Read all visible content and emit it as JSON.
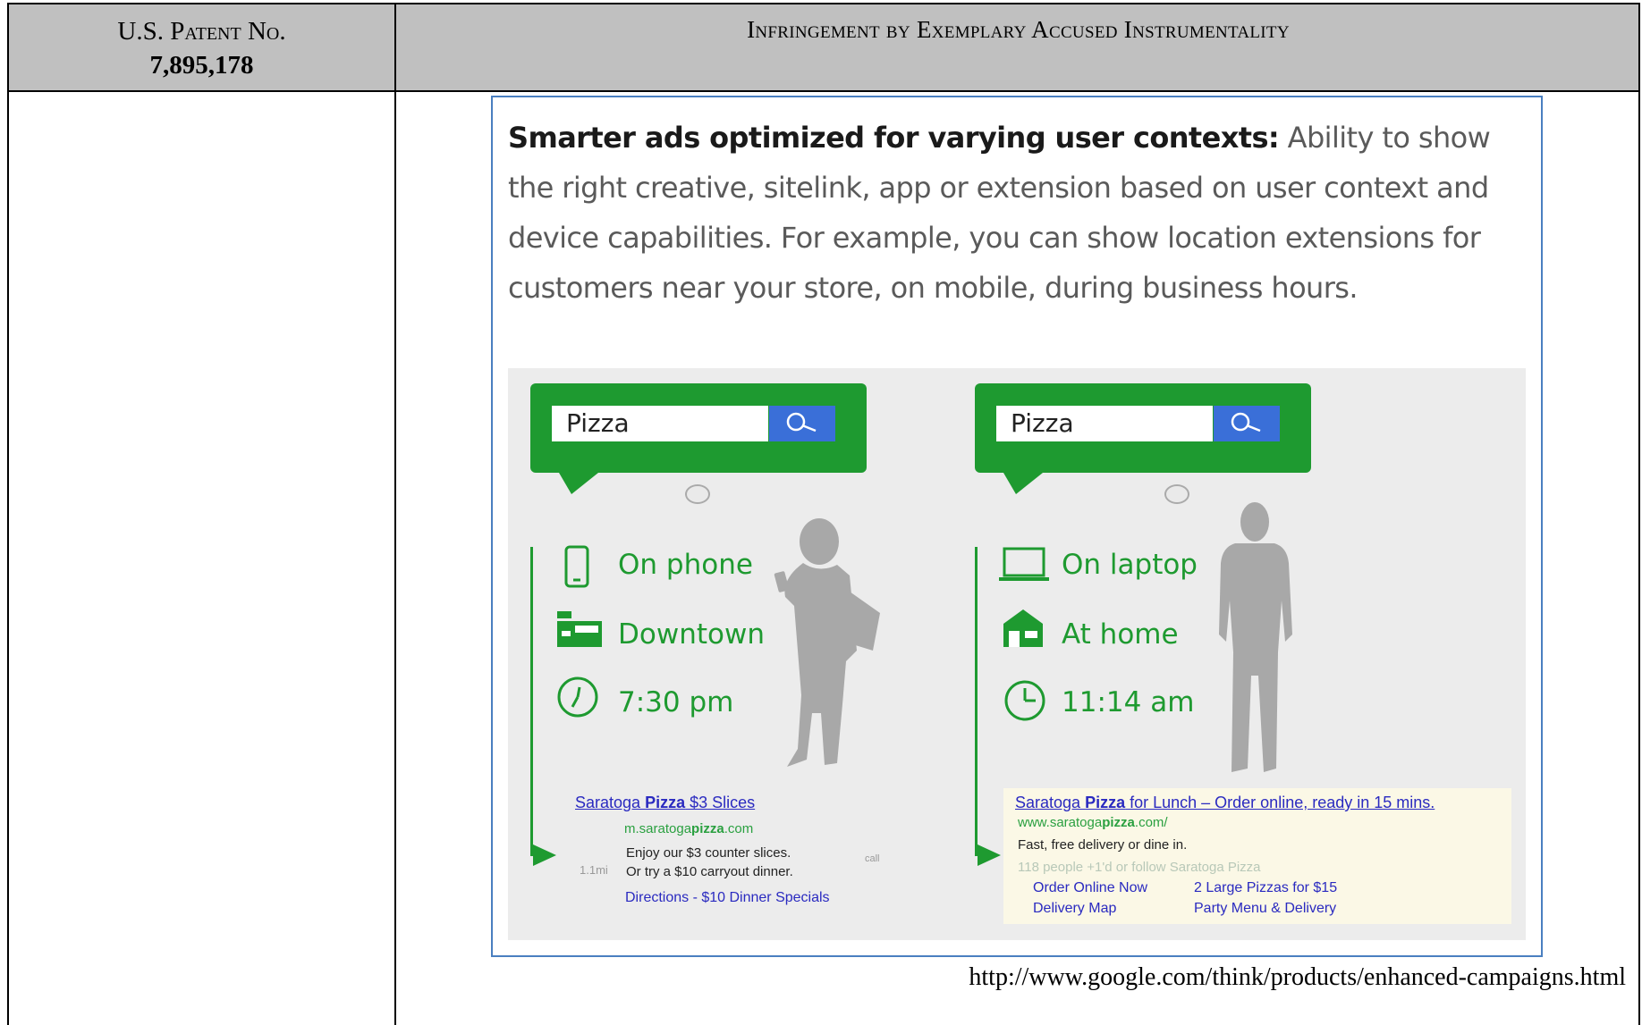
{
  "table": {
    "col1_header_line1": "U.S. Patent No.",
    "col1_header_line2": "7,895,178",
    "col2_header": "Infringement by Exemplary Accused Instrumentality"
  },
  "excerpt": {
    "bold_lead": "Smarter ads optimized for varying user contexts:",
    "body": " Ability to show the right creative, sitelink, app or extension based on user context and device capabilities. For example, you can show location extensions for customers near your store, on mobile, during business hours."
  },
  "graphic": {
    "left": {
      "search_query": "Pizza",
      "contexts": [
        {
          "icon": "phone-icon",
          "label": "On phone"
        },
        {
          "icon": "storefront-icon",
          "label": "Downtown"
        },
        {
          "icon": "clock-icon",
          "label": "7:30 pm"
        }
      ],
      "ad": {
        "title_pre": "Saratoga ",
        "title_bold": "Pizza",
        "title_post": " $3 Slices",
        "url_pre": "m.saratoga",
        "url_bold": "pizza",
        "url_post": ".com",
        "line1": "Enjoy our $3 counter slices.",
        "line2": "Or try a $10 carryout dinner.",
        "distance": "1.1mi",
        "call": "call",
        "links": "Directions - $10 Dinner Specials"
      }
    },
    "right": {
      "search_query": "Pizza",
      "contexts": [
        {
          "icon": "laptop-icon",
          "label": "On laptop"
        },
        {
          "icon": "home-icon",
          "label": "At home"
        },
        {
          "icon": "clock-icon",
          "label": "11:14 am"
        }
      ],
      "ad": {
        "title_pre": "Saratoga ",
        "title_bold": "Pizza",
        "title_post": " for Lunch – Order online, ready in 15 mins.",
        "url_pre": "www.saratoga",
        "url_bold": "pizza",
        "url_post": ".com/",
        "line1": "Fast, free delivery or dine in.",
        "social": "118 people +1'd or follow Saratoga Pizza",
        "sitelinks": [
          "Order Online Now",
          "2 Large Pizzas for $15",
          "Delivery Map",
          "Party Menu & Delivery"
        ]
      }
    },
    "colors": {
      "green": "#1e9a30",
      "blue_button": "#3a6fd8",
      "link_blue": "#2a2ac0",
      "frame_blue": "#4a7fc0",
      "header_gray": "#c0c0c0"
    }
  },
  "source_url": "http://www.google.com/think/products/enhanced-campaigns.html"
}
